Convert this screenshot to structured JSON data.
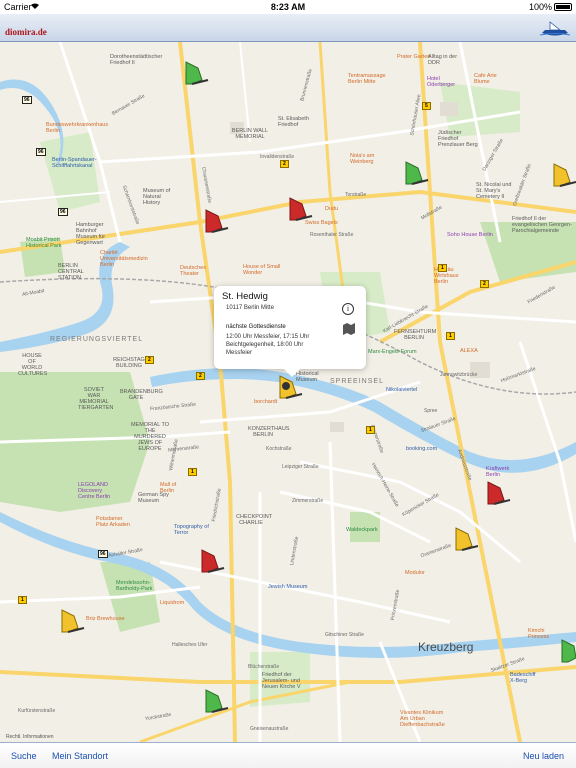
{
  "status_bar": {
    "carrier": "Carrier",
    "time": "8:23 AM",
    "battery": "100%"
  },
  "header": {
    "logo": "diomira.de"
  },
  "callout": {
    "title": "St. Hedwig",
    "address": "10117 Berlin Mitte",
    "next_heading": "nächste Gottesdienste",
    "services": "12:00 Uhr Messfeier, 17:15 Uhr Beichtgelegenheit, 18:00 Uhr Messfeier",
    "info_glyph": "i"
  },
  "map": {
    "area_label": "Kreuzberg",
    "legal": "Rechtl. Informationen",
    "districts": [
      "REGIERUNGSVIERTEL",
      "SPREEINSEL"
    ],
    "pois": {
      "dorotheen": "Dorotheenstädtischer Friedhof II",
      "prater": "Prater Garten",
      "alltag": "Alltag in der DDR",
      "tentra": "Tentramassage Berlin Mitte",
      "hotel_oder": "Hotel Oderberger",
      "cafe_arie": "Cafe Arie Blume",
      "bundeswehr": "Bundeswehrkrankenhaus Berlin",
      "wall": "BERLIN WALL MEMORIAL",
      "elisabeth": "St. Elisabeth Friedhof",
      "judischer": "Jüdischer Friedhof Prenzlauer Berg",
      "spandauer": "Berlin-Spandauer-Schifffahrtskanal",
      "museum_natural": "Museum of Natural History",
      "noias": "Noia's am Weinberg",
      "nicolai": "St. Nicolai und St. Mary's Cemetery II",
      "georgen": "Friedhof II der evangelischen Georgen-Parochialgemeinde",
      "hamburger": "Hamburger Bahnhof Museum für Gegenwart",
      "dudu": "Dudu",
      "swiss": "Swiss Bagels",
      "soho": "Soho House Berlin",
      "moabit": "Moabit Prison Historical Park",
      "berlin_station": "BERLIN CENTRAL STATION",
      "charite": "Charité Universitätsmedizin Berlin",
      "deutsches": "Deutsches Theater",
      "house_burger": "House of Small Wonder",
      "hofbrau": "Hofbräu Wirtshaus Berlin",
      "fernsehturm": "FERNSEHTURM BERLIN",
      "marx": "Marx-Engels-Forum",
      "alexa": "ALEXA",
      "house_world": "HOUSE OF WORLD CULTURES",
      "reichstag": "REICHSTAG BUILDING",
      "soviet": "SOVIET WAR MEMORIAL TIERGARTEN",
      "brandenburg": "BRANDENBURG GATE",
      "german_hist": "German Historical Museum",
      "borchardt": "borchardt",
      "nikolai": "Nikolaiviertel",
      "memorial": "MEMORIAL TO THE MURDERED JEWS OF EUROPE",
      "konzerthaus": "KONZERTHAUS BERLIN",
      "booking": "booking.com",
      "kraftwerk": "Kraftwerk Berlin",
      "legoland": "LEGOLAND Discovery Centre Berlin",
      "mall": "Mall of Berlin",
      "spy": "German Spy Museum",
      "potsdamer": "Potsdamer Platz Arkaden",
      "checkpoint": "CHECKPOINT CHARLIE",
      "topo": "Topography of Terror",
      "waldeck": "Waldeckpark",
      "jewish": "Jewish Museum",
      "mendelssohn": "Mendelssohn-Bartholdy-Park",
      "liquidrom": "Liquidrom",
      "briz": "Briz Brewhouse",
      "modulor": "Modulor",
      "kimchi": "Kimchi Princess",
      "badeschiff": "Badeschiff X-Berg",
      "friedhof_jer": "Friedhof der Jerusalem- und Neuen Kirche V",
      "vivantes": "Vivantes Klinikum Am Urban Dieffenbachstraße"
    },
    "streets": {
      "chausseestr": "Chausseestraße",
      "torstrasse": "Torstraße",
      "invaliden": "Invalidenstraße",
      "karl": "Karl-Liebknecht-Straße",
      "friedrich": "Friedrichstraße",
      "leipziger": "Leipziger Straße",
      "gitschiner": "Gitschiner Straße",
      "oranien": "Oranienstraße",
      "yorck": "Yorckstraße",
      "skalitzer": "Skalitzer Straße",
      "alt_moabit": "Alt-Moabit",
      "franz": "Französische Straße",
      "bernauer": "Bernauer Straße",
      "heinrich": "Heinrich-Heine-Straße",
      "kopenicker": "Köpenicker Straße",
      "schonhauser": "Schönhauser Allee",
      "mollstr": "Mollstraße",
      "gruner": "Grunerstraße",
      "scharnhorst": "Scharnhorststraße",
      "greifswalder": "Greifswalder Straße",
      "danziger": "Danziger Straße",
      "holzmarkt": "Holzmarktstraße",
      "wilhelm": "Wilhelmstraße",
      "stralauer": "Stralauer Straße",
      "lindenstr": "Lindenstraße",
      "hallesches": "Hallesches Ufer",
      "bluecher": "Blücherstraße",
      "gneisenau": "Gneisenaustraße",
      "prinzenstr": "Prinzenstraße",
      "jannowitz": "Jannowitzbrücke",
      "zimmer": "Zimmerstraße",
      "anhalter": "Anhalter Straße",
      "mohrenstr": "Mohrenstraße",
      "ostbahnhof": "Andreasstraße",
      "sprem": "Spree",
      "koch": "Kochstraße",
      "brunnen": "Brunnenstraße",
      "rosenthaler": "Rosenthaler Straße",
      "friedenstr": "Friedenstraße",
      "kurfuersten": "Kurfürstenstraße"
    },
    "road_signs": [
      "96",
      "96",
      "96",
      "96",
      "2",
      "2",
      "2",
      "2",
      "1",
      "1",
      "1",
      "1",
      "5",
      "1"
    ]
  },
  "toolbar": {
    "search": "Suche",
    "my_location": "Mein Standort",
    "reload": "Neu laden"
  },
  "colors": {
    "water": "#a7d2f0",
    "park": "#c6e2b2",
    "road_main": "#f9d56b",
    "road_minor": "#ffffff",
    "accent": "#1b4fb1",
    "pin_green": "#4fb84a",
    "pin_red": "#cc2a2a",
    "pin_yellow": "#f2c22d"
  }
}
